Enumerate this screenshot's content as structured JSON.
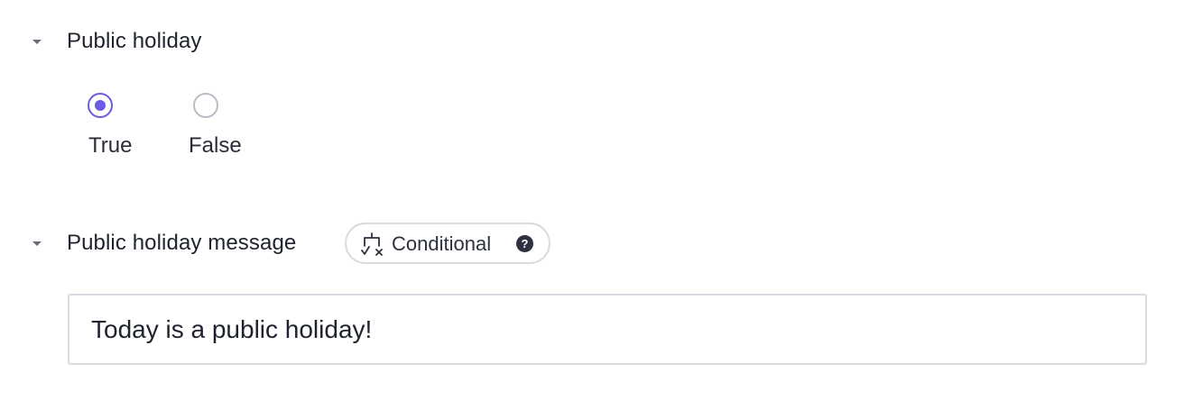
{
  "public_holiday": {
    "title": "Public holiday",
    "options": [
      {
        "label": "True",
        "selected": true
      },
      {
        "label": "False",
        "selected": false
      }
    ]
  },
  "public_holiday_message": {
    "title": "Public holiday message",
    "badge": {
      "label": "Conditional",
      "icon": "conditional-branch-icon",
      "help_icon": "question-mark-icon",
      "help_glyph": "?"
    },
    "value": "Today is a public holiday!"
  },
  "colors": {
    "accent": "#6b5ce7",
    "border": "#d9dbe2",
    "text": "#1f2330"
  }
}
